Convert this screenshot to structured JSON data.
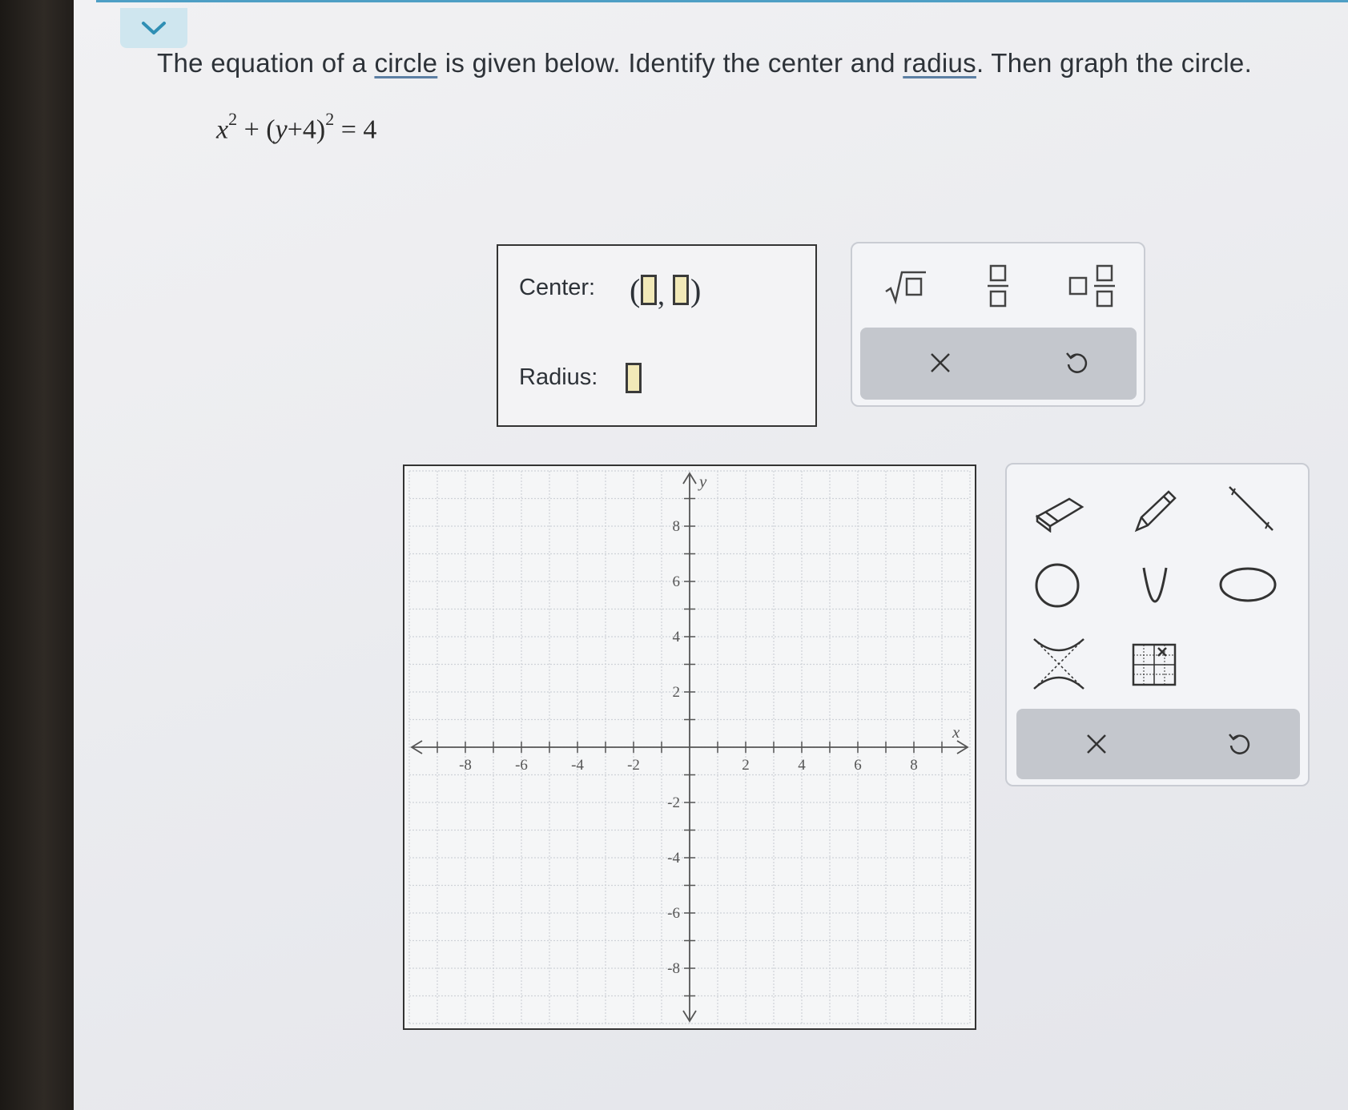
{
  "question": {
    "prefix": "The equation of a ",
    "link1": "circle",
    "middle": " is given below. Identify the center and ",
    "link2": "radius",
    "suffix": ". Then graph the circle."
  },
  "equation": {
    "x": "x",
    "exp1": "2",
    "plus": " + (",
    "y": "y",
    "inner": "+4)",
    "exp2": "2",
    "rhs": " = 4"
  },
  "answer": {
    "center_label": "Center:",
    "radius_label": "Radius:",
    "center_open": "(",
    "center_comma": ",",
    "center_close": ")",
    "center_x": "",
    "center_y": "",
    "radius_value": ""
  },
  "keypad": {
    "sqrt_icon": "sqrt-template-icon",
    "fraction_icon": "fraction-template-icon",
    "mixed_icon": "mixed-number-template-icon",
    "clear_icon": "x-icon",
    "undo_icon": "undo-icon"
  },
  "graph": {
    "x_label": "x",
    "y_label": "y",
    "x_ticks": [
      "-8",
      "-6",
      "-4",
      "-2",
      "2",
      "4",
      "6",
      "8"
    ],
    "y_ticks": [
      "8",
      "6",
      "4",
      "2",
      "-2",
      "-4",
      "-6",
      "-8"
    ],
    "x_range": [
      -10,
      10
    ],
    "y_range": [
      -10,
      10
    ],
    "grid": true
  },
  "tools": {
    "items": [
      "eraser-icon",
      "pencil-icon",
      "line-segment-icon",
      "circle-icon",
      "parabola-icon",
      "ellipse-icon",
      "hyperbola-icon",
      "point-grid-icon"
    ],
    "clear_icon": "x-icon",
    "undo_icon": "undo-icon"
  },
  "colors": {
    "accent": "#4e9fc5",
    "slot_fill": "#f2e9b8",
    "action_bar": "#c4c7cd"
  }
}
